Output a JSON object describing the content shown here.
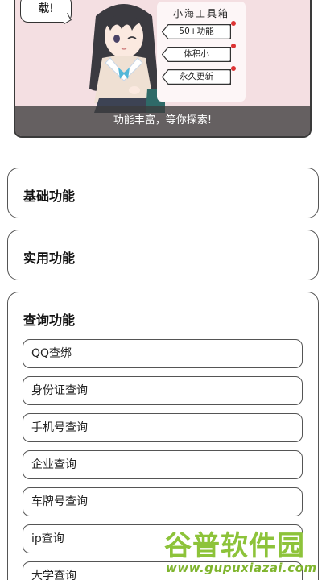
{
  "banner": {
    "bubble_text": "载!",
    "note_title": "小海工具箱",
    "tags": [
      "50+功能",
      "体积小",
      "永久更新"
    ],
    "caption": "功能丰富，等你探索!"
  },
  "sections": {
    "basic": {
      "title": "基础功能"
    },
    "practical": {
      "title": "实用功能"
    },
    "query": {
      "title": "查询功能",
      "items": [
        "QQ查绑",
        "身份证查询",
        "手机号查询",
        "企业查询",
        "车牌号查询",
        "ip查询",
        "大学查询"
      ]
    }
  },
  "watermark": {
    "name": "谷普软件园",
    "url": "www.gupuxiazai.com"
  }
}
